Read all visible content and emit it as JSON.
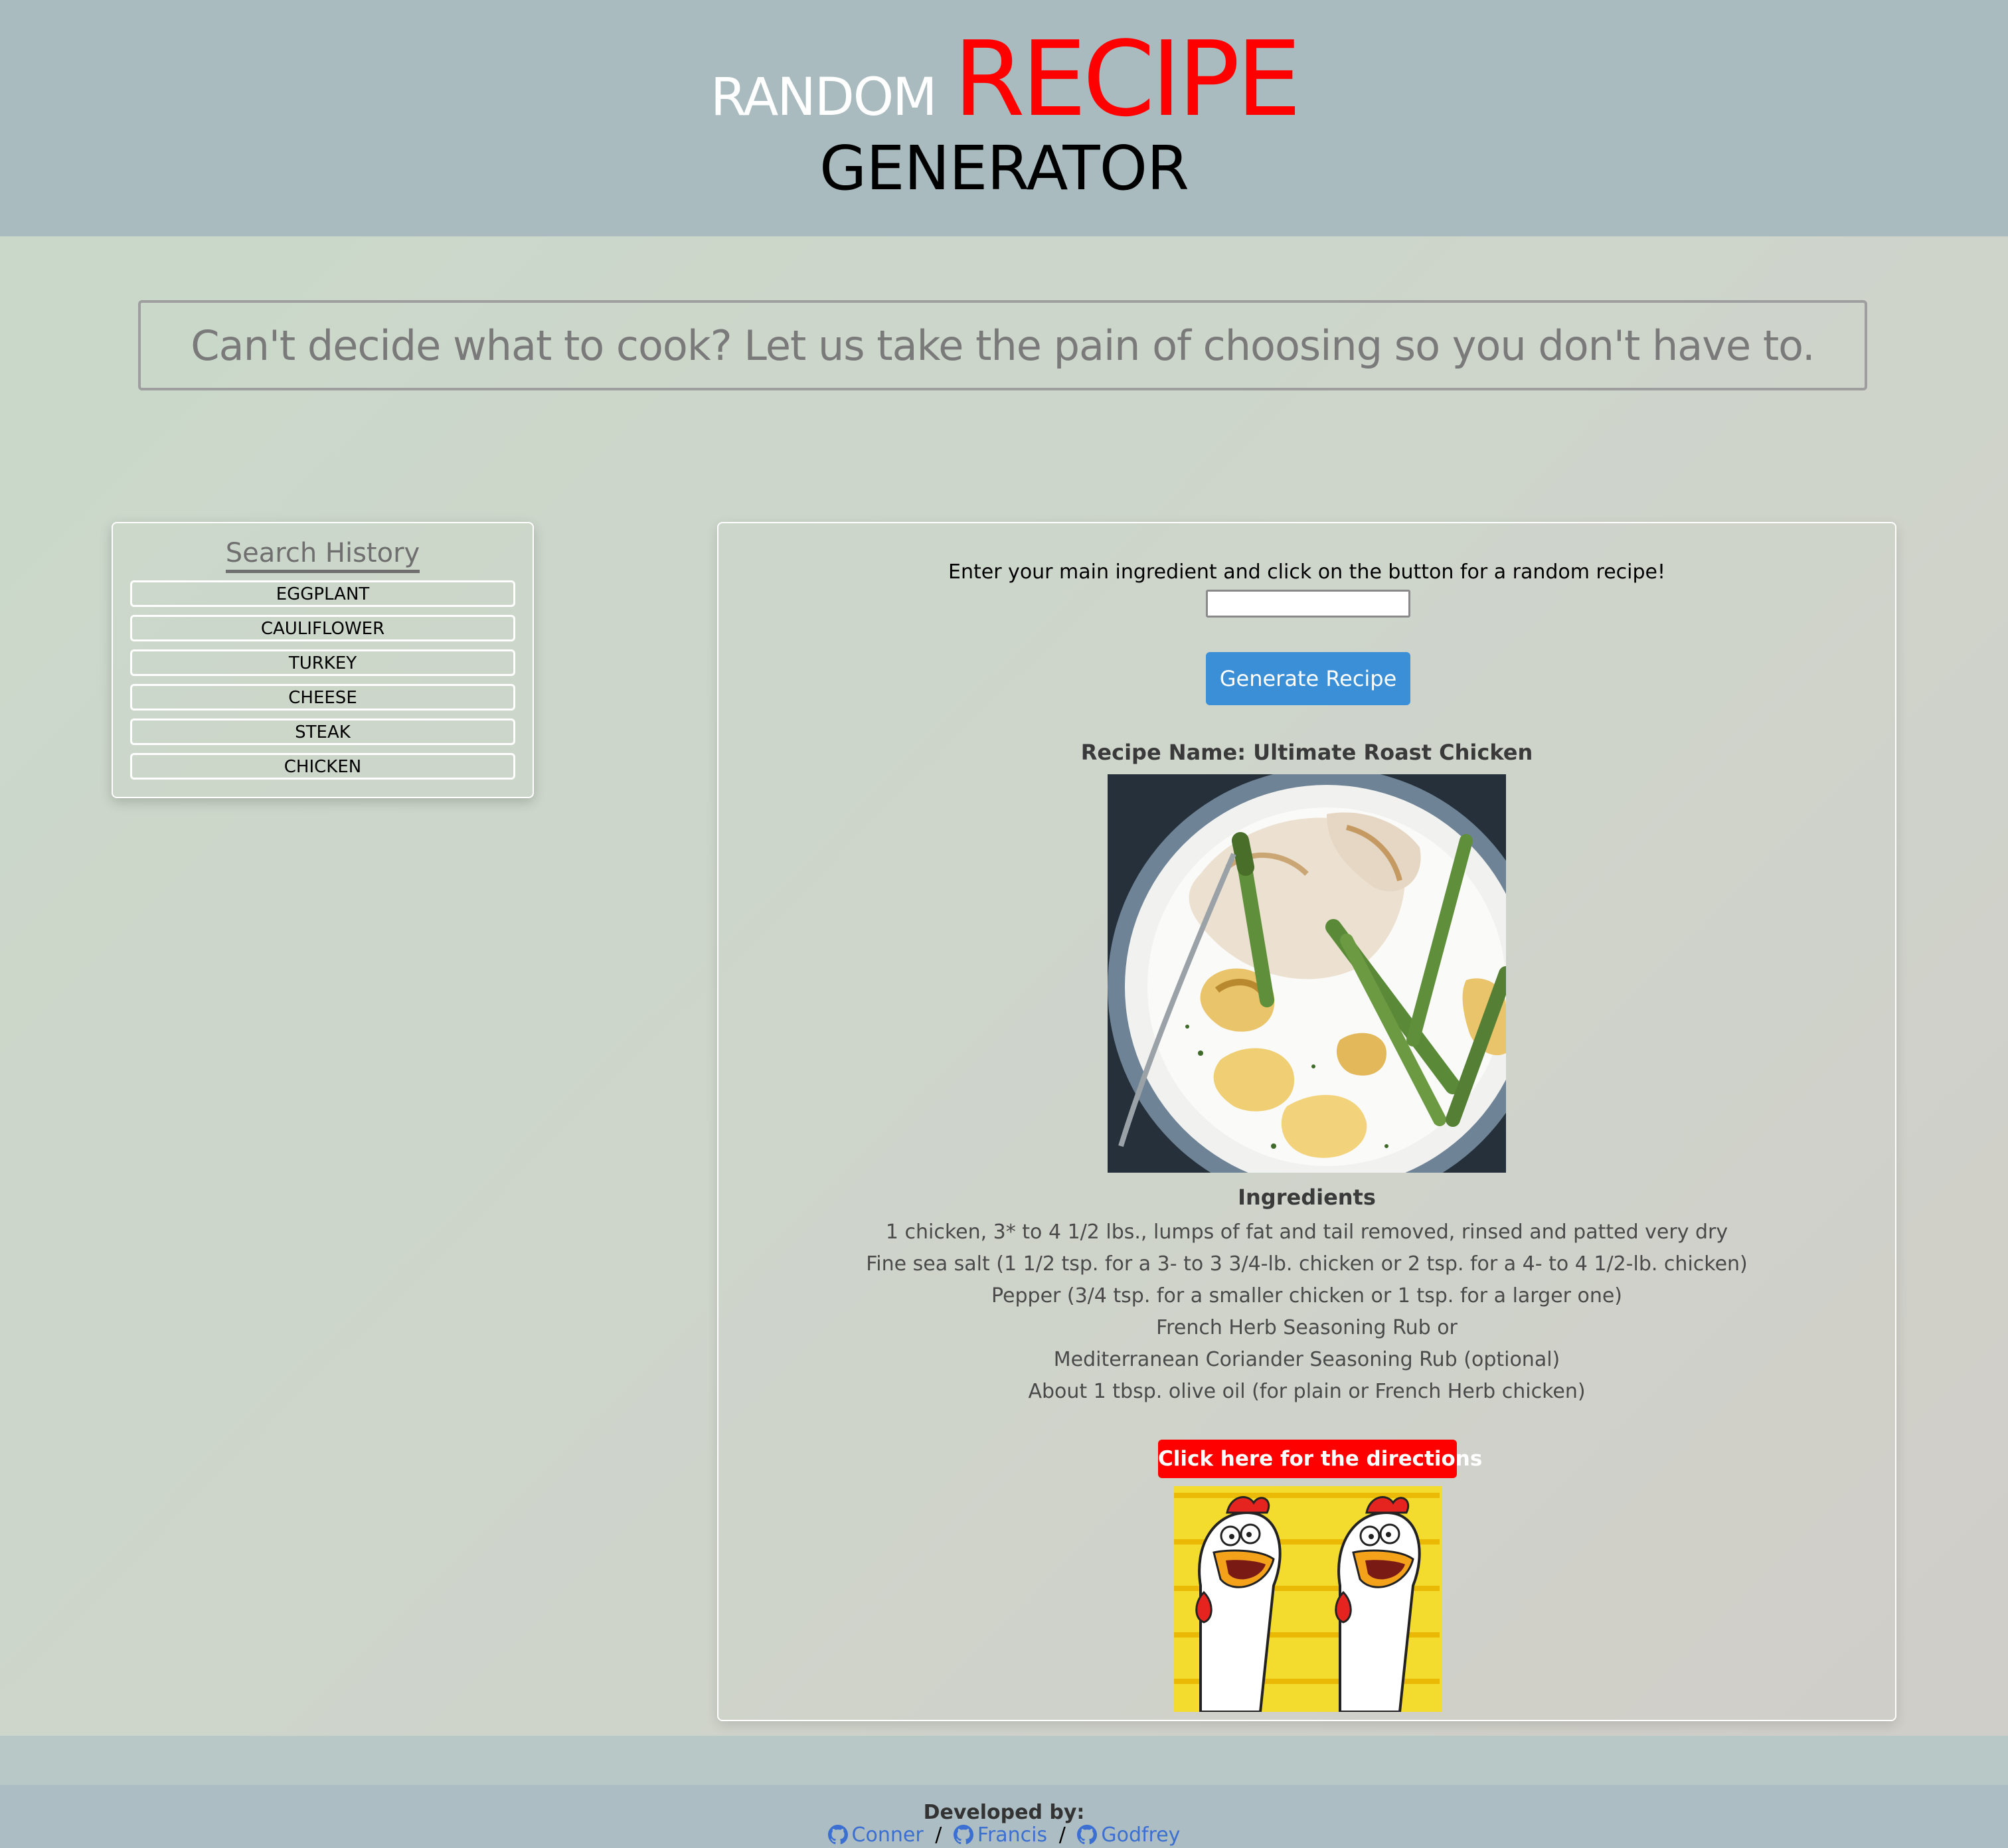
{
  "header": {
    "title_random": "RANDOM",
    "title_recipe": "RECIPE",
    "title_generator": "GENERATOR"
  },
  "tagline": "Can't decide what to cook? Let us take the pain of choosing so you don't have to.",
  "search_history": {
    "title": "Search History",
    "items": [
      "EGGPLANT",
      "CAULIFLOWER",
      "TURKEY",
      "CHEESE",
      "STEAK",
      "CHICKEN"
    ]
  },
  "main": {
    "prompt": "Enter your main ingredient and click on the button for a random recipe!",
    "input_value": "",
    "generate_label": "Generate Recipe",
    "recipe_name": "Recipe Name: Ultimate Roast Chicken",
    "ingredients_title": "Ingredients",
    "ingredients": [
      "1 chicken, 3* to 4 1/2 lbs., lumps of fat and tail removed, rinsed and patted very dry",
      "Fine sea salt (1 1/2 tsp. for a 3- to 3 3/4-lb. chicken or 2 tsp. for a 4- to 4 1/2-lb. chicken)",
      "Pepper (3/4 tsp. for a smaller chicken or 1 tsp. for a larger one)",
      "French Herb Seasoning Rub or",
      "Mediterranean Coriander Seasoning Rub (optional)",
      "About 1 tbsp. olive oil (for plain or French Herb chicken)"
    ],
    "directions_label": "Click here for the directions"
  },
  "footer": {
    "title": "Developed by:",
    "developers": [
      "Conner",
      "Francis",
      "Godfrey"
    ],
    "separator": "/",
    "icon": "github-icon"
  },
  "colors": {
    "header_bg": "#a9bbbf",
    "recipe_red": "#ff0000",
    "button_blue": "#3a8fd6",
    "link_blue": "#3b6fd1"
  }
}
